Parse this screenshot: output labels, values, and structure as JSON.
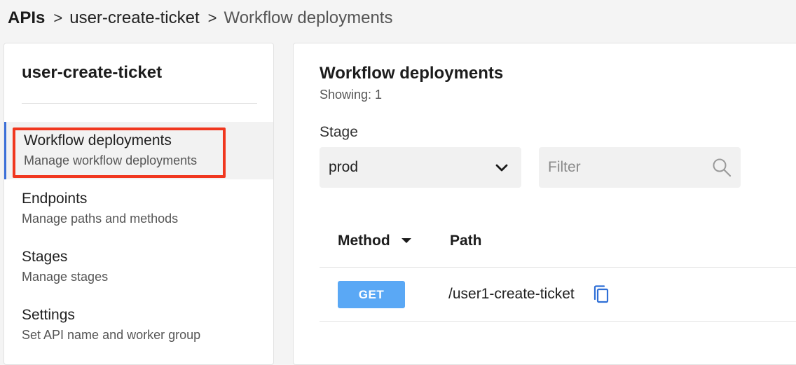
{
  "breadcrumb": {
    "root": "APIs",
    "separator": ">",
    "api": "user-create-ticket",
    "current": "Workflow deployments"
  },
  "sidebar": {
    "title": "user-create-ticket",
    "items": [
      {
        "label": "Workflow deployments",
        "sub": "Manage workflow deployments",
        "active": true
      },
      {
        "label": "Endpoints",
        "sub": "Manage paths and methods",
        "active": false
      },
      {
        "label": "Stages",
        "sub": "Manage stages",
        "active": false
      },
      {
        "label": "Settings",
        "sub": "Set API name and worker group",
        "active": false
      }
    ]
  },
  "main": {
    "title": "Workflow deployments",
    "showing": "Showing: 1",
    "stage_label": "Stage",
    "stage_value": "prod",
    "filter_placeholder": "Filter",
    "table": {
      "headers": {
        "method": "Method",
        "path": "Path"
      },
      "rows": [
        {
          "method": "GET",
          "path": "/user1-create-ticket"
        }
      ]
    }
  },
  "colors": {
    "accent": "#3b6fd8",
    "highlight": "#f0371f",
    "method_get": "#5aa8f5"
  },
  "icons": {
    "select": "chevron-down-icon",
    "filter": "search-icon",
    "sort": "caret-down-icon",
    "copy": "copy-icon"
  }
}
